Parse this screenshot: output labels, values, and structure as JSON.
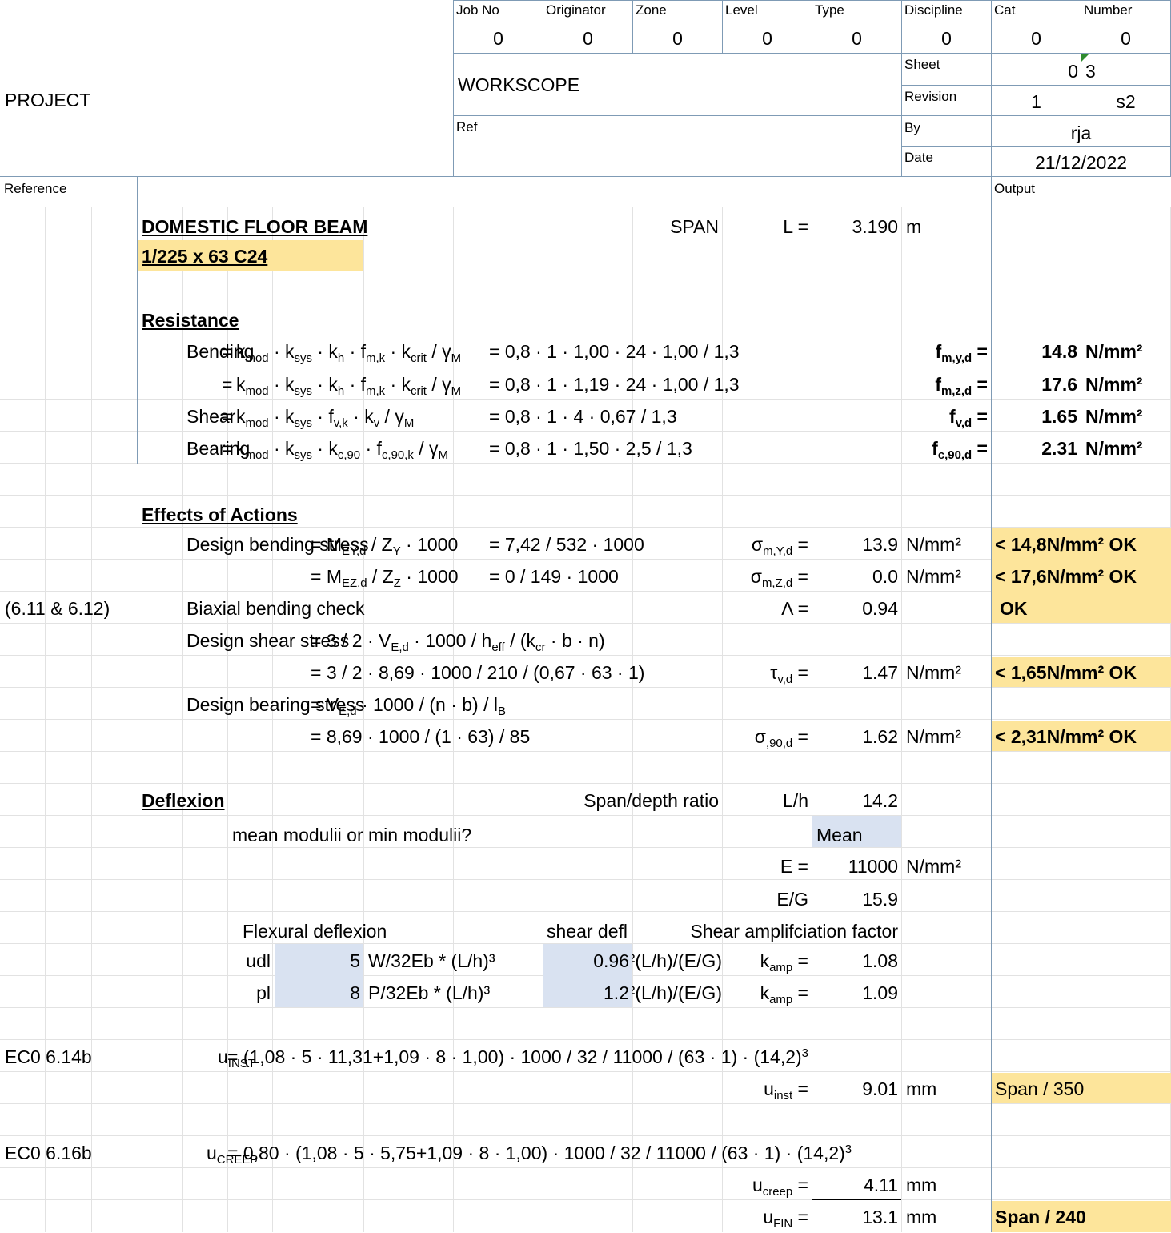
{
  "header": {
    "project_label": "PROJECT",
    "workscope_label": "WORKSCOPE",
    "ref_label": "Ref",
    "fields": [
      {
        "label": "Job No",
        "value": "0"
      },
      {
        "label": "Originator",
        "value": "0"
      },
      {
        "label": "Zone",
        "value": "0"
      },
      {
        "label": "Level",
        "value": "0"
      },
      {
        "label": "Type",
        "value": "0"
      },
      {
        "label": "Discipline",
        "value": "0"
      },
      {
        "label": "Cat",
        "value": "0"
      },
      {
        "label": "Number",
        "value": "0"
      }
    ],
    "sheet_label": "Sheet",
    "sheet_value": "0",
    "sheet_value_2": "3",
    "revision_label": "Revision",
    "revision_value": "1",
    "revision_value_2": "s2",
    "by_label": "By",
    "by_value": "rja",
    "date_label": "Date",
    "date_value": "21/12/2022"
  },
  "columns": {
    "reference": "Reference",
    "output": "Output"
  },
  "beam": {
    "title": "DOMESTIC FLOOR BEAM",
    "section": "1/225 x 63 C24",
    "span_label": "SPAN",
    "L_label": "L =",
    "L_value": "3.190",
    "L_unit": "m"
  },
  "resistance": {
    "heading": "Resistance",
    "rows": [
      {
        "label": "Bending",
        "eq_prefix": "=",
        "eq_formula": "k<sub>mod</sub> · k<sub>sys</sub> · k<sub>h</sub> · f<sub>m,k</sub> · k<sub>crit</sub> / γ<sub>M</sub>",
        "eq_subst": "= 0,8 · 1 · 1,00 · 24 · 1,00 / 1,3",
        "symbol": "f<sub>m,y,d</sub> =",
        "value": "14.8",
        "unit": "N/mm²"
      },
      {
        "label": "",
        "eq_prefix": "=",
        "eq_formula": "k<sub>mod</sub> · k<sub>sys</sub> · k<sub>h</sub> · f<sub>m,k</sub> · k<sub>crit</sub> / γ<sub>M</sub>",
        "eq_subst": "= 0,8 · 1 · 1,19 · 24 · 1,00 / 1,3",
        "symbol": "f<sub>m,z,d</sub> =",
        "value": "17.6",
        "unit": "N/mm²"
      },
      {
        "label": "Shear",
        "eq_prefix": "=",
        "eq_formula": "k<sub>mod</sub> · k<sub>sys</sub> · f<sub>v,k</sub> · k<sub>v</sub> / γ<sub>M</sub>",
        "eq_subst": "= 0,8 · 1 · 4 · 0,67 / 1,3",
        "symbol": "f<sub>v,d</sub> =",
        "value": "1.65",
        "unit": "N/mm²"
      },
      {
        "label": "Bearing",
        "eq_prefix": "=",
        "eq_formula": "k<sub>mod</sub> · k<sub>sys</sub> · k<sub>c,90</sub> · f<sub>c,90,k</sub> / γ<sub>M</sub>",
        "eq_subst": "= 0,8 · 1 · 1,50 · 2,5 / 1,3",
        "symbol": "f<sub>c,90,d</sub> =",
        "value": "2.31",
        "unit": "N/mm²"
      }
    ]
  },
  "effects": {
    "heading": "Effects of Actions",
    "bending_label": "Design bending stress",
    "bending_y_formula": "= M<sub>EY,d</sub> / Z<sub>Y</sub> · 1000",
    "bending_y_subst": "= 7,42 / 532 · 1000",
    "bending_y_symbol": "σ<sub>m,Y,d</sub> =",
    "bending_y_value": "13.9",
    "bending_y_unit": "N/mm²",
    "bending_y_check": "< 14,8N/mm²  OK",
    "bending_z_formula": "= M<sub>EZ,d</sub> / Z<sub>Z</sub> · 1000",
    "bending_z_subst": "= 0 / 149 · 1000",
    "bending_z_symbol": "σ<sub>m,Z,d</sub> =",
    "bending_z_value": "0.0",
    "bending_z_unit": "N/mm²",
    "bending_z_check": "< 17,6N/mm²  OK",
    "biaxial_ref": "(6.11 & 6.12)",
    "biaxial_label": "Biaxial bending check",
    "biaxial_symbol": "Λ =",
    "biaxial_value": "0.94",
    "biaxial_check": "OK",
    "shear_label": "Design shear stress",
    "shear_formula": "= 3 / 2 · V<sub>E,d</sub> · 1000 / h<sub>eff</sub> / (k<sub>cr</sub> · b · n)",
    "shear_subst": "= 3 / 2 · 8,69 · 1000 / 210 / (0,67 · 63 · 1)",
    "shear_symbol": "τ<sub>v,d</sub> =",
    "shear_value": "1.47",
    "shear_unit": "N/mm²",
    "shear_check": "< 1,65N/mm²  OK",
    "bearing_label": "Design bearing stress",
    "bearing_formula": "= V<sub>E,d</sub> · 1000 / (n · b) / l<sub>B</sub>",
    "bearing_subst": "= 8,69 · 1000 / (1 · 63) / 85",
    "bearing_symbol": "σ<sub>,90,d</sub> =",
    "bearing_value": "1.62",
    "bearing_unit": "N/mm²",
    "bearing_check": "< 2,31N/mm²  OK"
  },
  "deflexion": {
    "heading": "Deflexion",
    "span_depth_label": "Span/depth ratio",
    "Lh_label": "L/h",
    "Lh_value": "14.2",
    "moduli_question": "mean modulii or min modulii?",
    "moduli_choice": "Mean",
    "E_label": "E =",
    "E_value": "11000",
    "E_unit": "N/mm²",
    "EG_label": "E/G",
    "EG_value": "15.9",
    "flexural_label": "Flexural deflexion",
    "shear_defl_label": "shear defl",
    "amp_label": "Shear amplifciation factor",
    "udl_label": "udl",
    "udl_coef": "5",
    "udl_formula": "W/32Eb * (L/h)³",
    "udl_shear": "0.96",
    "udl_shear_formula": "(E/G)/(L/h)²",
    "udl_k_label": "k<sub>amp</sub> =",
    "udl_k_value": "1.08",
    "pl_label": "pl",
    "pl_coef": "8",
    "pl_formula": "P/32Eb * (L/h)³",
    "pl_shear": "1.2",
    "pl_shear_formula": "(E/G)/(L/h)²",
    "pl_k_label": "k<sub>amp</sub> =",
    "pl_k_value": "1.09",
    "inst_ref": "EC0 6.14b",
    "inst_prefix": "u<sub>INST</sub>",
    "inst_eq": "= (1,08 · 5 · 11,31+1,09 · 8 · 1,00) · 1000 / 32 / 11000 / (63 · 1) · (14,2)<sup>3</sup>",
    "inst_symbol": "u<sub>inst</sub> =",
    "inst_value": "9.01",
    "inst_unit": "mm",
    "inst_output": "Span / 350",
    "creep_ref": "EC0 6.16b",
    "creep_prefix": "u<sub>CREEP</sub>",
    "creep_eq": "= 0,80 · (1,08 · 5 · 5,75+1,09 · 8 · 1,00) · 1000 / 32 / 11000 / (63 · 1) · (14,2)<sup>3</sup>",
    "creep_symbol": "u<sub>creep</sub> =",
    "creep_value": "4.11",
    "creep_unit": "mm",
    "fin_symbol": "u<sub>FIN</sub> =",
    "fin_value": "13.1",
    "fin_unit": "mm",
    "fin_output": "Span / 240"
  },
  "colors": {
    "highlight": "#fde59b",
    "input": "#d9e2f1",
    "gridline": "#e2e2e2",
    "border": "#7f9bb5",
    "flag": "#2e8b2e"
  }
}
